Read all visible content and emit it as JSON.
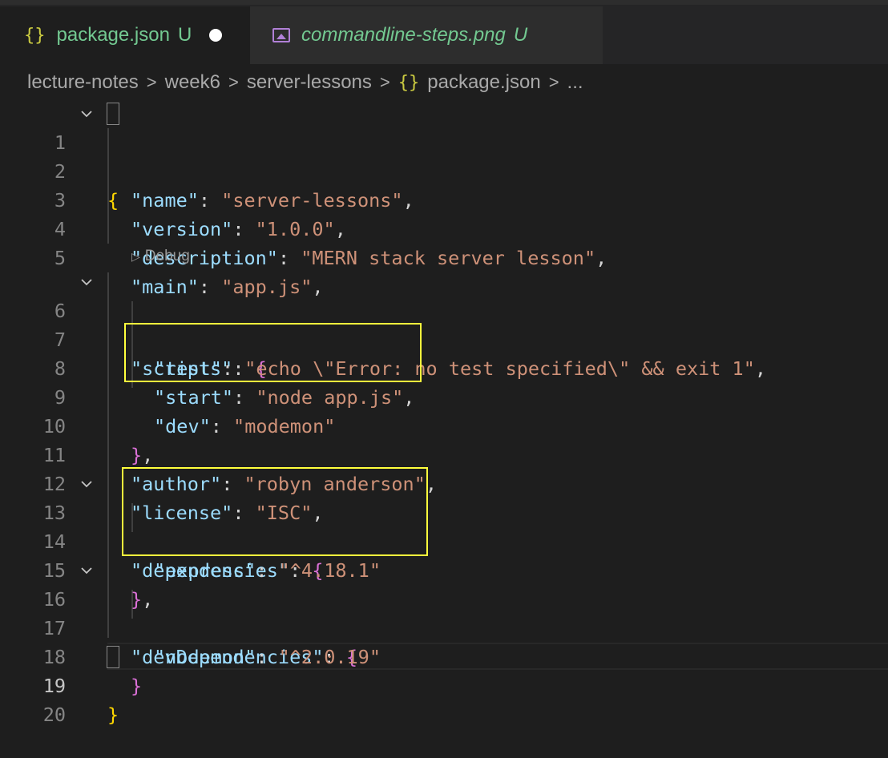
{
  "tabs": [
    {
      "label": "package.json",
      "status": "U",
      "icon": "json-braces-icon",
      "active": true,
      "dirty": true
    },
    {
      "label": "commandline-steps.png",
      "status": "U",
      "icon": "image-icon",
      "active": false
    }
  ],
  "tab_icon_glyph": "{}",
  "breadcrumb": {
    "items": [
      "lecture-notes",
      "week6",
      "server-lessons",
      "package.json",
      "..."
    ],
    "separator": ">"
  },
  "codelens": {
    "label": "Debug",
    "icon": "play-outline-icon"
  },
  "editor": {
    "current_line": 19,
    "lines": [
      {
        "n": "1"
      },
      {
        "n": "2"
      },
      {
        "n": "3"
      },
      {
        "n": "4"
      },
      {
        "n": "5"
      },
      {
        "n": "6"
      },
      {
        "n": "7"
      },
      {
        "n": "8"
      },
      {
        "n": "9"
      },
      {
        "n": "10"
      },
      {
        "n": "11"
      },
      {
        "n": "12"
      },
      {
        "n": "13"
      },
      {
        "n": "14"
      },
      {
        "n": "15"
      },
      {
        "n": "16"
      },
      {
        "n": "17"
      },
      {
        "n": "18"
      },
      {
        "n": "19"
      },
      {
        "n": "20"
      }
    ],
    "code": {
      "open_brace": "{",
      "close_brace": "}",
      "name_key": "\"name\"",
      "name_val": "\"server-lessons\"",
      "version_key": "\"version\"",
      "version_val": "\"1.0.0\"",
      "description_key": "\"description\"",
      "description_val": "\"MERN stack server lesson\"",
      "main_key": "\"main\"",
      "main_val": "\"app.js\"",
      "scripts_key": "\"scripts\"",
      "test_key": "\"test\"",
      "test_val": "\"echo \\\"Error: no test specified\\\" && exit 1\"",
      "start_key": "\"start\"",
      "start_val": "\"node app.js\"",
      "dev_key": "\"dev\"",
      "dev_val": "\"modemon\"",
      "author_key": "\"author\"",
      "author_val": "\"robyn anderson\"",
      "license_key": "\"license\"",
      "license_val": "\"ISC\"",
      "dependencies_key": "\"dependencies\"",
      "express_key": "\"express\"",
      "express_val": "\"^4.18.1\"",
      "devDependencies_key": "\"devDependencies\"",
      "nodemon_key": "\"nodemon\"",
      "nodemon_val": "\"^2.0.19\""
    }
  },
  "colors": {
    "background": "#1e1e1e",
    "json_key": "#9cdcfe",
    "json_string": "#ce9178",
    "bracket_level1": "#ffd700",
    "bracket_level2": "#da70d6",
    "highlight_box": "#ffff3c",
    "untracked": "#73c991"
  }
}
